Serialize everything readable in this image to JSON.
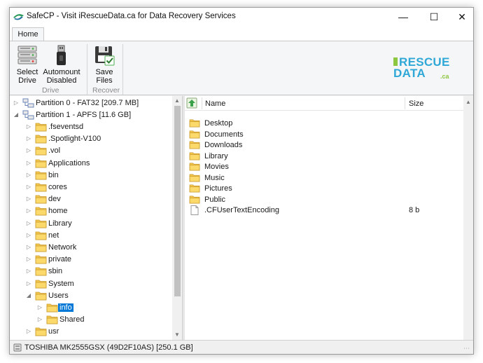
{
  "window": {
    "title": "SafeCP - Visit iRescueData.ca for Data Recovery Services",
    "minimize_glyph": "—",
    "maximize_glyph": "☐",
    "close_glyph": "✕"
  },
  "ribbon": {
    "tab": "Home",
    "buttons": {
      "select_drive": [
        "Select",
        "Drive"
      ],
      "automount": [
        "Automount",
        "Disabled"
      ],
      "save_files": [
        "Save",
        "Files"
      ]
    },
    "groups": {
      "drive": "Drive",
      "recover": "Recover"
    }
  },
  "logo": {
    "line1": "RESCUE",
    "line2": "DATA",
    "suffix": ".ca"
  },
  "tree": {
    "partition0": "Partition 0 - FAT32 [209.7 MB]",
    "partition1": "Partition 1 - APFS [11.6 GB]",
    "folders": [
      ".fseventsd",
      ".Spotlight-V100",
      ".vol",
      "Applications",
      "bin",
      "cores",
      "dev",
      "home",
      "Library",
      "net",
      "Network",
      "private",
      "sbin",
      "System",
      "Users"
    ],
    "users_children": [
      "info",
      "Shared"
    ],
    "last": "usr",
    "selected": "info"
  },
  "list": {
    "col_name": "Name",
    "col_size": "Size",
    "rows": [
      {
        "name": "Desktop",
        "size": ""
      },
      {
        "name": "Documents",
        "size": ""
      },
      {
        "name": "Downloads",
        "size": ""
      },
      {
        "name": "Library",
        "size": ""
      },
      {
        "name": "Movies",
        "size": ""
      },
      {
        "name": "Music",
        "size": ""
      },
      {
        "name": "Pictures",
        "size": ""
      },
      {
        "name": "Public",
        "size": ""
      },
      {
        "name": ".CFUserTextEncoding",
        "size": "8 b"
      }
    ]
  },
  "status": {
    "drive": "TOSHIBA MK2555GSX (49D2F10AS) [250.1 GB]"
  },
  "colors": {
    "accent": "#0078d7",
    "folder": "#f5c84c",
    "logo_blue": "#2fa8d7",
    "logo_green": "#8dc63f"
  }
}
